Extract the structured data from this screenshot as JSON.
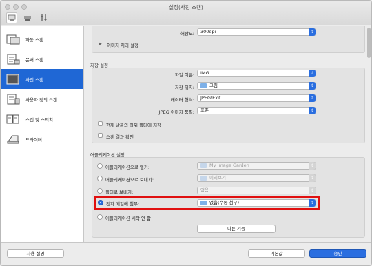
{
  "window": {
    "title": "설정(사진 스캔)"
  },
  "toolbar": {
    "icons": [
      "scan-from-computer-icon",
      "scan-from-operation-panel-icon",
      "general-settings-icon"
    ]
  },
  "sidebar": {
    "items": [
      {
        "label": "자동 스캔",
        "icon": "auto-scan-icon",
        "active": false
      },
      {
        "label": "문서 스캔",
        "icon": "document-scan-icon",
        "active": false
      },
      {
        "label": "사진 스캔",
        "icon": "photo-scan-icon",
        "active": true
      },
      {
        "label": "사용자 정의 스캔",
        "icon": "custom-scan-icon",
        "active": false
      },
      {
        "label": "스캔 및 스티치",
        "icon": "scan-and-stitch-icon",
        "active": false
      },
      {
        "label": "드라이버",
        "icon": "driver-icon",
        "active": false
      }
    ]
  },
  "scan_options": {
    "resolution_label": "해상도:",
    "resolution_value": "300dpi",
    "image_processing_label": "이미지 처리 설정"
  },
  "save_settings": {
    "title": "저장 설정",
    "file_name_label": "파일 이름:",
    "file_name_value": "IMG",
    "save_in_label": "저장 위치:",
    "save_in_value": "그림",
    "data_format_label": "데이터 형식:",
    "data_format_value": "JPEG/Exif",
    "jpeg_quality_label": "JPEG 이미지 품질:",
    "jpeg_quality_value": "표준",
    "subfolder_label": "현재 날짜의 하위 폴더에 저장",
    "check_result_label": "스캔 결과 확인"
  },
  "app_settings": {
    "title": "어플리케이션 설정",
    "open_app_label": "어플리케이션으로 열기:",
    "open_app_value": "My Image Garden",
    "send_app_label": "어플리케이션으로 보내기:",
    "send_app_value": "미리보기",
    "send_folder_label": "폴더로 보내기:",
    "send_folder_value": "없음",
    "attach_email_label": "전자 메일에 첨부:",
    "attach_email_value": "없음(수동 첨부)",
    "no_app_label": "어플리케이션 시작 안 함",
    "more_functions_label": "다른 기능"
  },
  "footer": {
    "instructions_label": "사용 설명",
    "defaults_label": "기본값",
    "ok_label": "승인"
  },
  "colors": {
    "accent": "#2a6ee0",
    "sidebar_active": "#1f67d5",
    "highlight": "#e01010"
  }
}
